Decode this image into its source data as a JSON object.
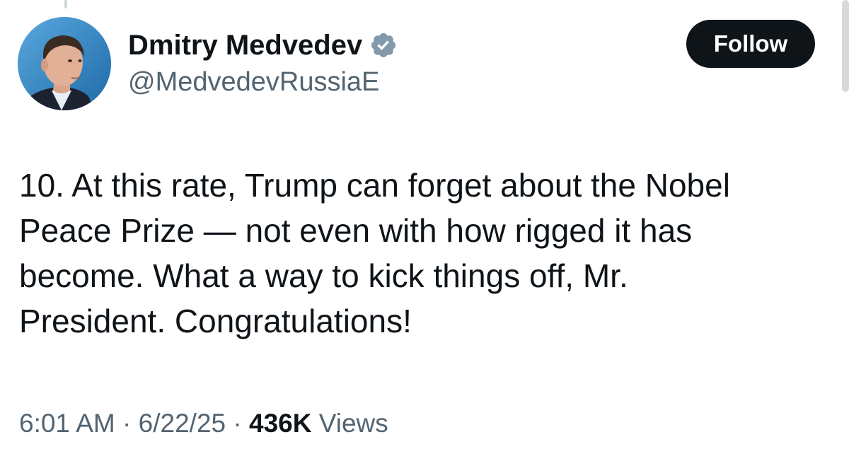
{
  "author": {
    "display_name": "Dmitry Medvedev",
    "handle": "@MedvedevRussiaE",
    "verified": true,
    "verified_badge_color": "#829aab"
  },
  "actions": {
    "follow_label": "Follow"
  },
  "tweet": {
    "lines": [
      "10. At this rate, Trump can forget about the Nobel",
      "Peace Prize — not even with how rigged it has",
      "become. What a way to kick things off, Mr.",
      "President. Congratulations!"
    ]
  },
  "meta": {
    "time": "6:01 AM",
    "separator": " · ",
    "date": "6/22/25",
    "views_count": "436K",
    "views_label": " Views"
  },
  "colors": {
    "text_primary": "#0f1419",
    "text_secondary": "#536471",
    "follow_bg": "#0f1419",
    "avatar_bg": "#3f8fc9"
  }
}
